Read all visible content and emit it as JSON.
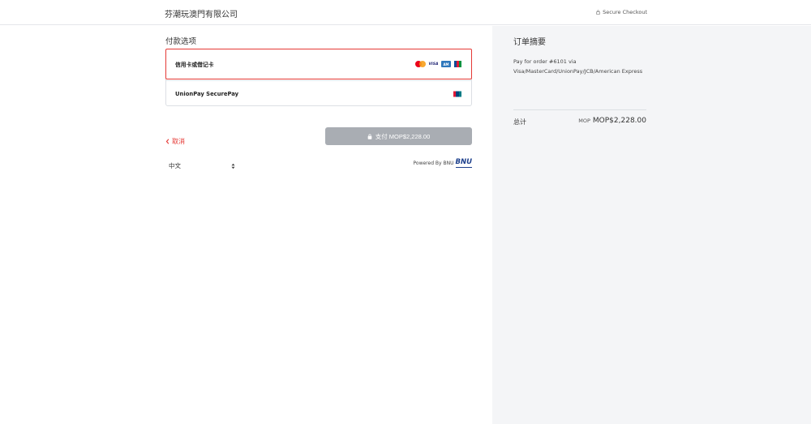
{
  "header": {
    "store_name": "芬潮玩澳門有限公司",
    "secure_label": "Secure Checkout"
  },
  "payment": {
    "section_title": "付款选项",
    "options": [
      {
        "label": "信用卡或借记卡",
        "selected": true,
        "icons": [
          "mastercard-icon",
          "visa-icon",
          "amex-icon",
          "jcb-icon"
        ]
      },
      {
        "label": "UnionPay SecurePay",
        "selected": false,
        "icons": [
          "unionpay-icon"
        ]
      }
    ],
    "pay_button_label": "支付 MOP$2,228.00",
    "cancel_label": "取消"
  },
  "footer": {
    "language": "中文",
    "powered_by": "Powered By BNU",
    "bnu_logo": "BNU"
  },
  "summary": {
    "title": "订单摘要",
    "description": "Pay for order #6101 via Visa/MasterCard/UnionPay/JCB/American Express",
    "total_label": "总计",
    "total_currency": "MOP",
    "total_value": "MOP$2,228.00"
  },
  "colors": {
    "accent": "#e53935",
    "button_disabled": "#a9adb3",
    "panel_bg": "#f4f5f7"
  }
}
